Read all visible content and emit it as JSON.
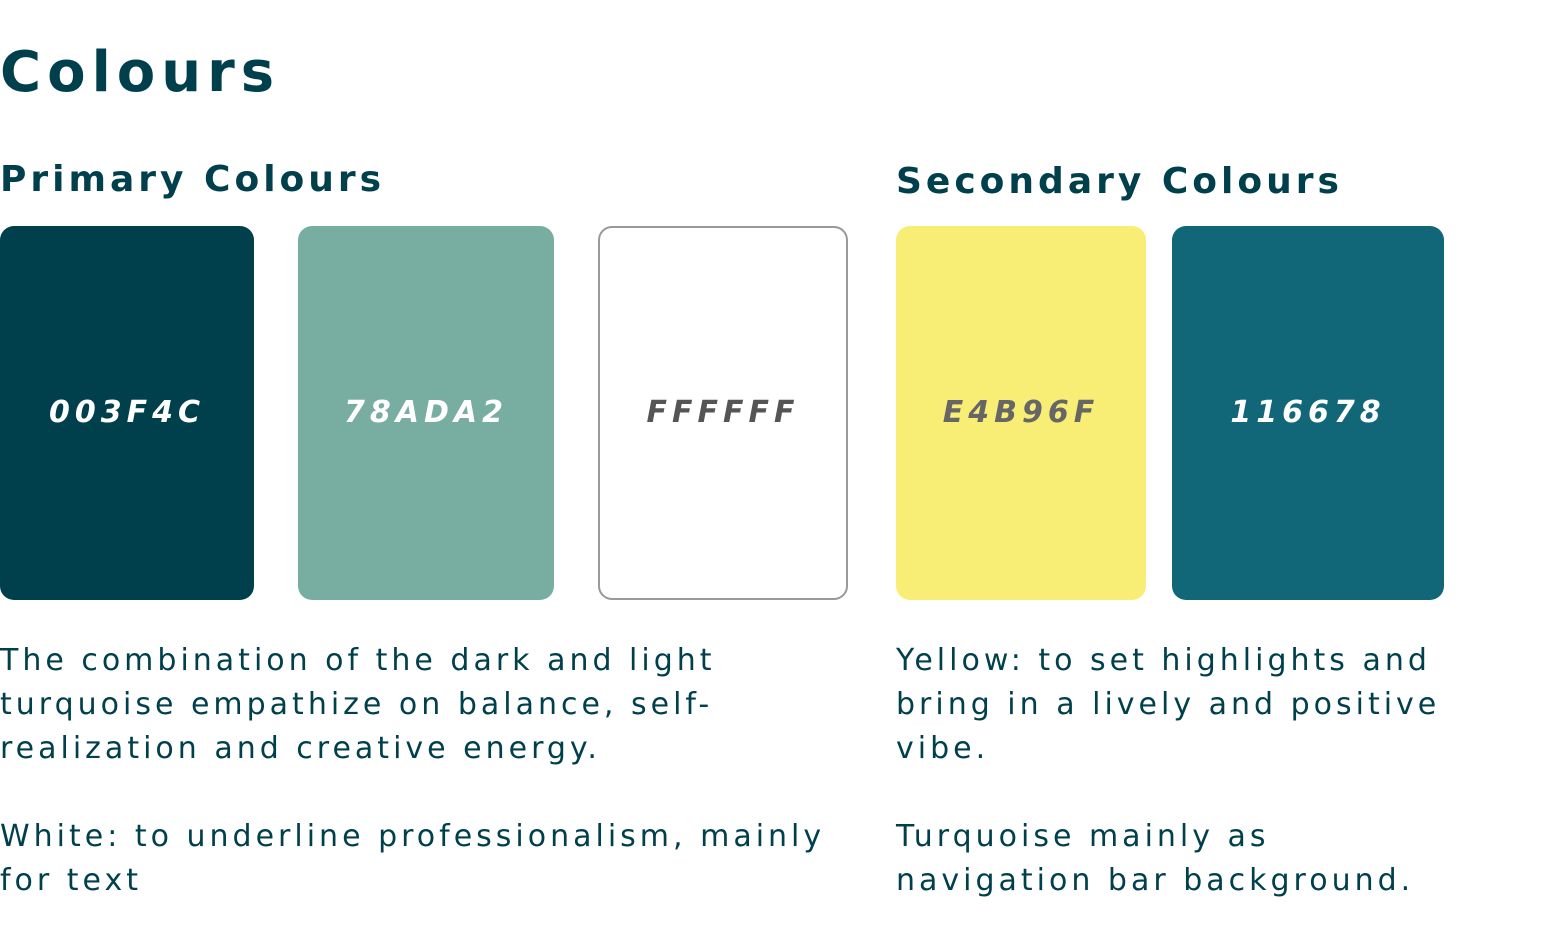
{
  "title": "Colours",
  "primary": {
    "heading": "Primary Colours",
    "swatches": [
      {
        "code": "003F4C",
        "color": "#003f4c",
        "text_color": "#ffffff",
        "border": "none"
      },
      {
        "code": "78ADA2",
        "color": "#78ada2",
        "text_color": "#ffffff",
        "border": "none"
      },
      {
        "code": "FFFFFF",
        "color": "#ffffff",
        "text_color": "#555555",
        "border": "#999999"
      }
    ],
    "description_1": "The combination of the dark and light turquoise empathize on balance, self-realization and creative energy.",
    "description_2": "White: to underline professionalism, mainly for text"
  },
  "secondary": {
    "heading": "Secondary Colours",
    "swatches": [
      {
        "code": "E4B96F",
        "color": "#f9ee75",
        "text_color": "#666666",
        "border": "none"
      },
      {
        "code": "116678",
        "color": "#116678",
        "text_color": "#ffffff",
        "border": "none"
      }
    ],
    "description_1": "Yellow: to set highlights and bring in a lively and positive vibe.",
    "description_2": "Turquoise mainly as navigation bar background."
  }
}
